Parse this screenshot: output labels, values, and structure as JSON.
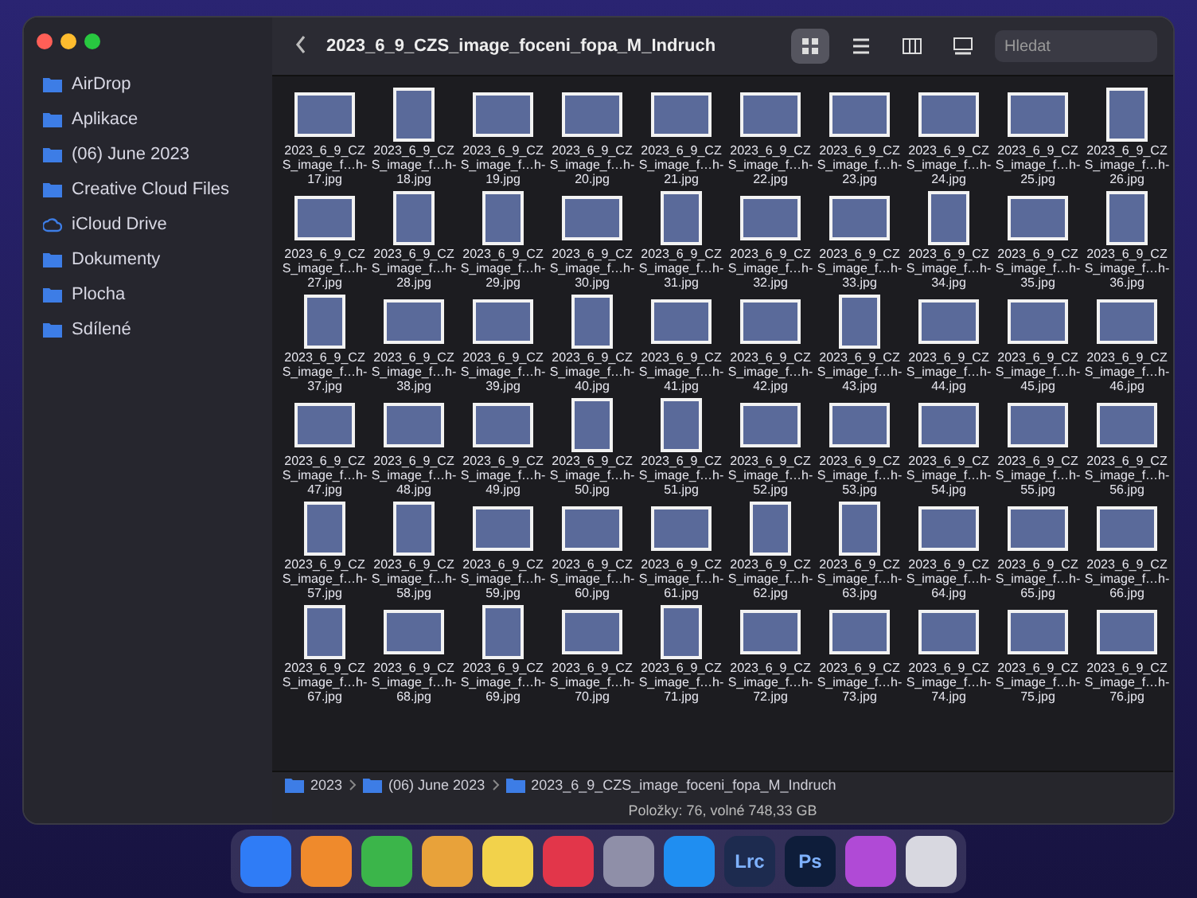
{
  "window": {
    "title": "2023_6_9_CZS_image_foceni_fopa_M_Indruch"
  },
  "toolbar": {
    "views": [
      {
        "kind": "icons",
        "selected": true
      },
      {
        "kind": "list",
        "selected": false
      },
      {
        "kind": "columns",
        "selected": false
      },
      {
        "kind": "gallery",
        "selected": false
      }
    ],
    "search": {
      "placeholder": "Hledat"
    }
  },
  "sidebar": {
    "items": [
      {
        "label": "AirDrop",
        "kind": "folder"
      },
      {
        "label": "Aplikace",
        "kind": "folder"
      },
      {
        "label": "(06) June 2023",
        "kind": "folder"
      },
      {
        "label": "Creative Cloud Files",
        "kind": "folder"
      },
      {
        "label": "iCloud Drive",
        "kind": "cloud"
      },
      {
        "label": "Dokumenty",
        "kind": "folder"
      },
      {
        "label": "Plocha",
        "kind": "folder"
      },
      {
        "label": "Sdílené",
        "kind": "folder"
      }
    ]
  },
  "files": [
    {
      "name": "2023_6_9_CZS_image_f…h-17.jpg",
      "kind": "landscape"
    },
    {
      "name": "2023_6_9_CZS_image_f…h-18.jpg",
      "kind": "portrait"
    },
    {
      "name": "2023_6_9_CZS_image_f…h-19.jpg",
      "kind": "landscape"
    },
    {
      "name": "2023_6_9_CZS_image_f…h-20.jpg",
      "kind": "landscape"
    },
    {
      "name": "2023_6_9_CZS_image_f…h-21.jpg",
      "kind": "landscape"
    },
    {
      "name": "2023_6_9_CZS_image_f…h-22.jpg",
      "kind": "landscape"
    },
    {
      "name": "2023_6_9_CZS_image_f…h-23.jpg",
      "kind": "landscape"
    },
    {
      "name": "2023_6_9_CZS_image_f…h-24.jpg",
      "kind": "landscape"
    },
    {
      "name": "2023_6_9_CZS_image_f…h-25.jpg",
      "kind": "landscape"
    },
    {
      "name": "2023_6_9_CZS_image_f…h-26.jpg",
      "kind": "portrait"
    },
    {
      "name": "2023_6_9_CZS_image_f…h-27.jpg",
      "kind": "landscape"
    },
    {
      "name": "2023_6_9_CZS_image_f…h-28.jpg",
      "kind": "portrait"
    },
    {
      "name": "2023_6_9_CZS_image_f…h-29.jpg",
      "kind": "portrait"
    },
    {
      "name": "2023_6_9_CZS_image_f…h-30.jpg",
      "kind": "landscape"
    },
    {
      "name": "2023_6_9_CZS_image_f…h-31.jpg",
      "kind": "portrait"
    },
    {
      "name": "2023_6_9_CZS_image_f…h-32.jpg",
      "kind": "landscape"
    },
    {
      "name": "2023_6_9_CZS_image_f…h-33.jpg",
      "kind": "landscape"
    },
    {
      "name": "2023_6_9_CZS_image_f…h-34.jpg",
      "kind": "portrait"
    },
    {
      "name": "2023_6_9_CZS_image_f…h-35.jpg",
      "kind": "landscape"
    },
    {
      "name": "2023_6_9_CZS_image_f…h-36.jpg",
      "kind": "portrait"
    },
    {
      "name": "2023_6_9_CZS_image_f…h-37.jpg",
      "kind": "portrait"
    },
    {
      "name": "2023_6_9_CZS_image_f…h-38.jpg",
      "kind": "landscape"
    },
    {
      "name": "2023_6_9_CZS_image_f…h-39.jpg",
      "kind": "landscape"
    },
    {
      "name": "2023_6_9_CZS_image_f…h-40.jpg",
      "kind": "portrait"
    },
    {
      "name": "2023_6_9_CZS_image_f…h-41.jpg",
      "kind": "landscape"
    },
    {
      "name": "2023_6_9_CZS_image_f…h-42.jpg",
      "kind": "landscape"
    },
    {
      "name": "2023_6_9_CZS_image_f…h-43.jpg",
      "kind": "portrait"
    },
    {
      "name": "2023_6_9_CZS_image_f…h-44.jpg",
      "kind": "landscape"
    },
    {
      "name": "2023_6_9_CZS_image_f…h-45.jpg",
      "kind": "landscape"
    },
    {
      "name": "2023_6_9_CZS_image_f…h-46.jpg",
      "kind": "landscape"
    },
    {
      "name": "2023_6_9_CZS_image_f…h-47.jpg",
      "kind": "landscape"
    },
    {
      "name": "2023_6_9_CZS_image_f…h-48.jpg",
      "kind": "landscape"
    },
    {
      "name": "2023_6_9_CZS_image_f…h-49.jpg",
      "kind": "landscape"
    },
    {
      "name": "2023_6_9_CZS_image_f…h-50.jpg",
      "kind": "portrait"
    },
    {
      "name": "2023_6_9_CZS_image_f…h-51.jpg",
      "kind": "portrait"
    },
    {
      "name": "2023_6_9_CZS_image_f…h-52.jpg",
      "kind": "landscape"
    },
    {
      "name": "2023_6_9_CZS_image_f…h-53.jpg",
      "kind": "landscape"
    },
    {
      "name": "2023_6_9_CZS_image_f…h-54.jpg",
      "kind": "landscape"
    },
    {
      "name": "2023_6_9_CZS_image_f…h-55.jpg",
      "kind": "landscape"
    },
    {
      "name": "2023_6_9_CZS_image_f…h-56.jpg",
      "kind": "landscape"
    },
    {
      "name": "2023_6_9_CZS_image_f…h-57.jpg",
      "kind": "portrait"
    },
    {
      "name": "2023_6_9_CZS_image_f…h-58.jpg",
      "kind": "portrait"
    },
    {
      "name": "2023_6_9_CZS_image_f…h-59.jpg",
      "kind": "landscape"
    },
    {
      "name": "2023_6_9_CZS_image_f…h-60.jpg",
      "kind": "landscape"
    },
    {
      "name": "2023_6_9_CZS_image_f…h-61.jpg",
      "kind": "landscape"
    },
    {
      "name": "2023_6_9_CZS_image_f…h-62.jpg",
      "kind": "portrait"
    },
    {
      "name": "2023_6_9_CZS_image_f…h-63.jpg",
      "kind": "portrait"
    },
    {
      "name": "2023_6_9_CZS_image_f…h-64.jpg",
      "kind": "landscape"
    },
    {
      "name": "2023_6_9_CZS_image_f…h-65.jpg",
      "kind": "landscape"
    },
    {
      "name": "2023_6_9_CZS_image_f…h-66.jpg",
      "kind": "landscape"
    },
    {
      "name": "2023_6_9_CZS_image_f…h-67.jpg",
      "kind": "portrait"
    },
    {
      "name": "2023_6_9_CZS_image_f…h-68.jpg",
      "kind": "landscape"
    },
    {
      "name": "2023_6_9_CZS_image_f…h-69.jpg",
      "kind": "portrait"
    },
    {
      "name": "2023_6_9_CZS_image_f…h-70.jpg",
      "kind": "landscape"
    },
    {
      "name": "2023_6_9_CZS_image_f…h-71.jpg",
      "kind": "portrait"
    },
    {
      "name": "2023_6_9_CZS_image_f…h-72.jpg",
      "kind": "landscape"
    },
    {
      "name": "2023_6_9_CZS_image_f…h-73.jpg",
      "kind": "landscape"
    },
    {
      "name": "2023_6_9_CZS_image_f…h-74.jpg",
      "kind": "landscape"
    },
    {
      "name": "2023_6_9_CZS_image_f…h-75.jpg",
      "kind": "landscape"
    },
    {
      "name": "2023_6_9_CZS_image_f…h-76.jpg",
      "kind": "landscape"
    }
  ],
  "path_bar": [
    "2023",
    "(06) June 2023",
    "2023_6_9_CZS_image_foceni_fopa_M_Indruch"
  ],
  "status_bar": "Položky: 76, volné 748,33 GB",
  "dock": [
    {
      "kind": "app",
      "color": "#2f7cf6"
    },
    {
      "kind": "app",
      "color": "#ef8a2c"
    },
    {
      "kind": "app",
      "color": "#3bb54a"
    },
    {
      "kind": "app",
      "color": "#e8a23a"
    },
    {
      "kind": "app",
      "color": "#f2d24b"
    },
    {
      "kind": "app",
      "color": "#e2364a"
    },
    {
      "kind": "app",
      "color": "#8f8fa8"
    },
    {
      "kind": "app",
      "color": "#1f8ef1"
    },
    {
      "kind": "text",
      "color": "#1d2b4f",
      "label": "Lrc"
    },
    {
      "kind": "text",
      "color": "#0e1d3a",
      "label": "Ps"
    },
    {
      "kind": "app",
      "color": "#b04ad6"
    },
    {
      "kind": "app",
      "color": "#d8d8e0"
    }
  ]
}
